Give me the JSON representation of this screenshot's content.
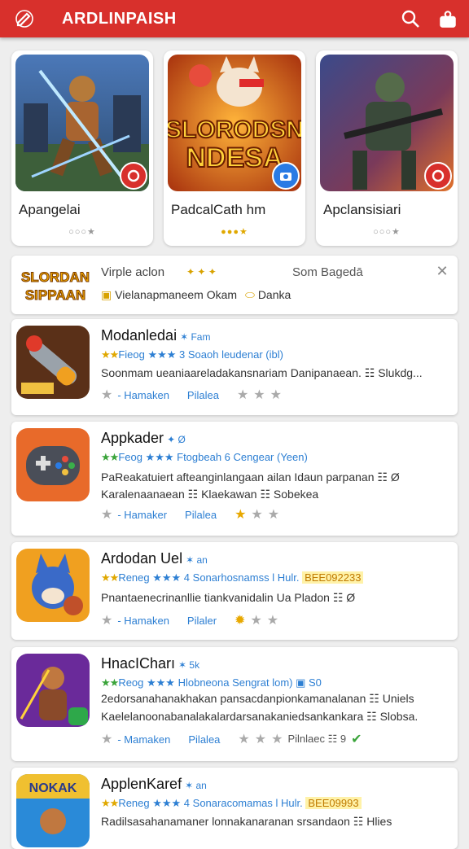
{
  "header": {
    "title": "ARDLINPAISH",
    "logo_icon": "edit-icon",
    "search_icon": "search-icon",
    "account_icon": "user-icon",
    "bar_color": "#d8302c"
  },
  "featured": [
    {
      "name": "Apangelai",
      "dots": "○○○★",
      "art_text": "",
      "badge_icon": "record-icon",
      "badge_color": "#d8302c"
    },
    {
      "name": "PadcalCath hm",
      "dots": "●●●★",
      "art_text": "SLORODSN NDESA",
      "badge_icon": "camera-icon",
      "badge_color": "#2a7be4"
    },
    {
      "name": "Apclansisiari",
      "dots": "○○○★",
      "art_text": "",
      "badge_icon": "record-icon",
      "badge_color": "#d8302c"
    }
  ],
  "ad": {
    "logo_text": "SLORDAN SIPPAAN",
    "title": "Virple aclon",
    "tag": "✦ ✦ ✦",
    "right_text": "Som Bagedā",
    "sub_1": "Vielanapmaneem Okam",
    "sub_2": "Danka",
    "close_icon": "close-icon"
  },
  "apps": [
    {
      "title": "Modanledai",
      "version": "✶ Fam",
      "rating_stars": "★★",
      "rating_text": "Fieog ★★★ 3 Soaoh leudenar (ibl)",
      "desc_1": "Soonmam ueaniaareladakansnariam Danipanaean. ☷ Slukdg...",
      "desc_2": "",
      "meta_1": "- Hamaken",
      "meta_2": "Pilalea",
      "stars_gold": 0,
      "extra": ""
    },
    {
      "title": "Appkader",
      "version": "✦ Ø",
      "rating_stars": "★★",
      "rating_text": "Feog ★★★ Ftogbeah 6 Cengear (Yeen)",
      "desc_1": "PaReakatuiert afteanginlangaan ailan Idaun parpanan ☷ Ø",
      "desc_2": "Karalenaanaean ☷ Klaekawan ☷ Sobekea",
      "meta_1": "- Hamaker",
      "meta_2": "Pilalea",
      "stars_gold": 1,
      "extra": ""
    },
    {
      "title": "Ardodan Uel",
      "version": "✶ an",
      "rating_stars": "★★",
      "rating_text": "Reneg ★★★ 4 Sonarhosnamss l Hulr.",
      "highlight": "BEE092233",
      "desc_1": "Pnantaenecrinanllie tiankvanidalin Ua Pladon ☷ Ø",
      "desc_2": "",
      "meta_1": "- Hamaken",
      "meta_2": "Pilaler",
      "stars_gold": 1,
      "extra": ""
    },
    {
      "title": "HnacICharı",
      "version": "✶ 5k",
      "rating_stars": "★★",
      "rating_text": "Reog ★★★ Hlobneona Sengrat lom) ▣ S0",
      "desc_1": "2edorsanahanakhakan pansacdanpionkamanalanan ☷ Uniels",
      "desc_2": "Kaelelanoonabanalakalardarsanakaniedsankankara ☷ Slobsa.",
      "meta_1": "- Mamaken",
      "meta_2": "Pilalea",
      "stars_gold": 0,
      "extra": "Pilnlaec ☷ 9"
    },
    {
      "title": "ApplenKaref",
      "version": "✶ an",
      "rating_stars": "★★",
      "rating_text": "Reneg ★★★ 4 Sonaracomamas l Hulr.",
      "highlight": "BEE09993",
      "desc_1": "Radilsasahanamaner lonnakanaranan srsandaon ☷ Hlies",
      "desc_2": "",
      "meta_1": "",
      "meta_2": "",
      "stars_gold": 0,
      "extra": ""
    }
  ]
}
